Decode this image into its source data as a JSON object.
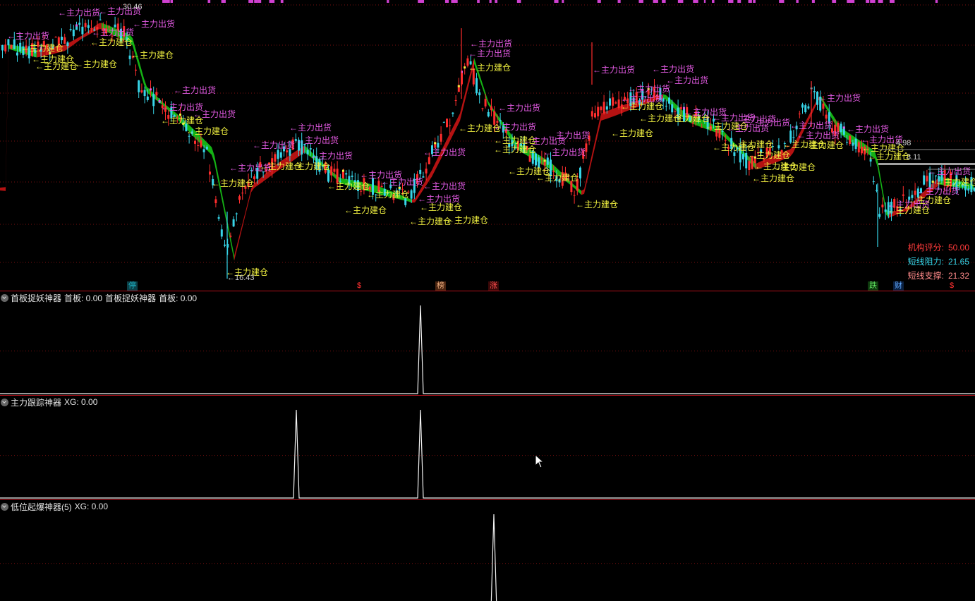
{
  "main_chart": {
    "price_high_label": "30.46",
    "price_low_label": "16.43",
    "label_ship": "←主力出货",
    "label_build": "←主力建仓",
    "partial_labels": [
      "4.98",
      "3.11"
    ],
    "badges": [
      {
        "text": "停",
        "color": "#1fb5c8",
        "bg": "#0b4048"
      },
      {
        "text": "$",
        "color": "#ff3030",
        "bg": "#300000"
      },
      {
        "text": "榜",
        "color": "#f0b080",
        "bg": "#4a2410"
      },
      {
        "text": "涨",
        "color": "#ff5050",
        "bg": "#3a0808"
      },
      {
        "text": "跌",
        "color": "#60e060",
        "bg": "#0e3a0e"
      },
      {
        "text": "财",
        "color": "#60a8ff",
        "bg": "#0a2040"
      },
      {
        "text": "$",
        "color": "#ff3030",
        "bg": "#300000"
      }
    ],
    "info": [
      {
        "label": "机构评分:",
        "value": "50.00",
        "color": "#ff3b3b"
      },
      {
        "label": "短线阻力:",
        "value": "21.65",
        "color": "#37d5e8"
      },
      {
        "label": "短线支撑:",
        "value": "21.32",
        "color": "#ff8a8a"
      }
    ]
  },
  "indicators": [
    {
      "title": "首板捉妖神器",
      "field1": "首板: 0.00",
      "title2": "首板捉妖神器",
      "field2": "首板: 0.00"
    },
    {
      "title": "主力跟踪神器",
      "field1": "XG: 0.00"
    },
    {
      "title": "低位起爆神器(5)",
      "field1": "XG: 0.00"
    }
  ],
  "colors": {
    "up": "#ff2d2d",
    "down": "#37d5e8",
    "ship": "#e35ae3",
    "build": "#f0f040",
    "band_green": "#16c416",
    "band_red": "#c81414",
    "grid": "#7a1010",
    "separator": "#b0101a"
  }
}
